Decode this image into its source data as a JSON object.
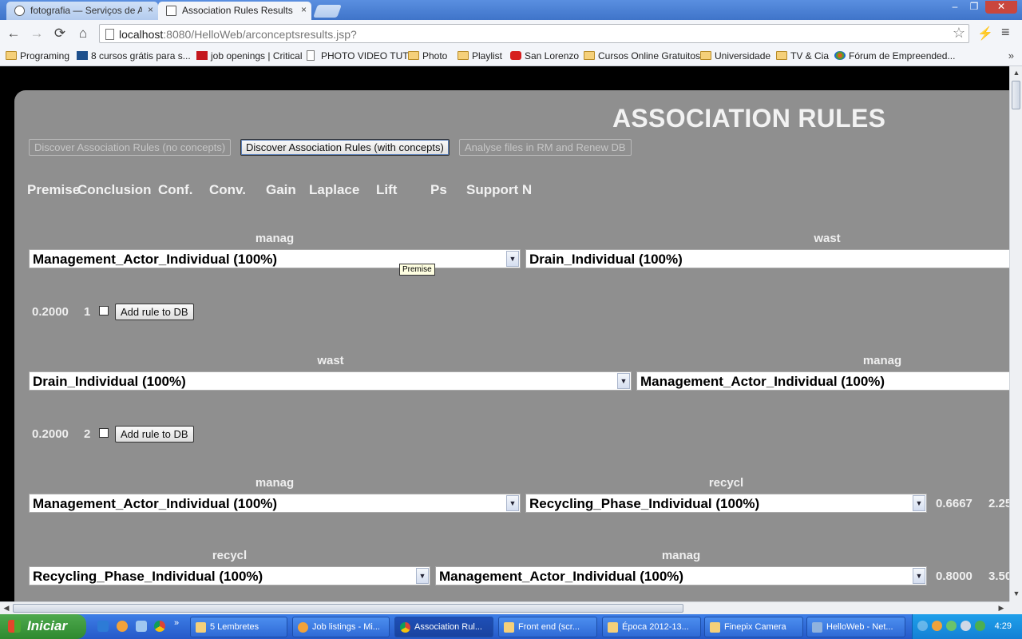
{
  "browser": {
    "tabs": [
      {
        "label": "fotografia — Serviços de Ac",
        "close": "×"
      },
      {
        "label": "Association Rules Results Pa",
        "close": "×"
      }
    ],
    "window_controls": {
      "minimize": "–",
      "restore": "❐",
      "close": "✕"
    },
    "nav": {
      "back": "←",
      "forward": "→",
      "reload": "⟳",
      "home": "⌂",
      "menu": "≡",
      "bolt": "⚡"
    },
    "url": {
      "host": "localhost",
      "path": ":8080/HelloWeb/arconceptsresults.jsp?"
    },
    "star": "☆",
    "bookmarks": [
      {
        "label": "Programing",
        "icon": "folder-icon"
      },
      {
        "label": "8 cursos grátis para s...",
        "icon": "site-icon"
      },
      {
        "label": "job openings | Critical",
        "icon": "site-icon"
      },
      {
        "label": "PHOTO VIDEO TUTS",
        "icon": "page-icon"
      },
      {
        "label": "Photo",
        "icon": "folder-icon"
      },
      {
        "label": "Playlist",
        "icon": "folder-icon"
      },
      {
        "label": "San Lorenzo",
        "icon": "youtube-icon"
      },
      {
        "label": "Cursos Online Gratuitos",
        "icon": "folder-icon"
      },
      {
        "label": "Universidade",
        "icon": "folder-icon"
      },
      {
        "label": "TV & Cia",
        "icon": "folder-icon"
      },
      {
        "label": "Fórum de Empreended...",
        "icon": "joomla-icon"
      }
    ],
    "bookmarks_more": "»"
  },
  "page": {
    "title": "ASSOCIATION RULES",
    "buttons": {
      "no_concepts": "Discover Association Rules (no concepts)",
      "with_concepts": "Discover Association Rules (with concepts)",
      "analyse": "Analyse files in RM and Renew DB"
    },
    "columns": [
      "Premise",
      "Conclusion",
      "Conf.",
      "Conv.",
      "Gain",
      "Laplace",
      "Lift",
      "Ps",
      "Support N"
    ],
    "tooltip": "Premise",
    "rules": [
      {
        "premise_cat": "manag",
        "premise": "Management_Actor_Individual (100%)",
        "conclusion_cat": "wast",
        "conclusion": "Drain_Individual (100%)",
        "conf": "",
        "conv": "",
        "support": "0.2000",
        "n": "1",
        "add_label": "Add rule to DB"
      },
      {
        "premise_cat": "wast",
        "premise": "Drain_Individual (100%)",
        "conclusion_cat": "manag",
        "conclusion": "Management_Actor_Individual (100%)",
        "conf": "",
        "conv": "",
        "support": "0.2000",
        "n": "2",
        "add_label": "Add rule to DB"
      },
      {
        "premise_cat": "manag",
        "premise": "Management_Actor_Individual (100%)",
        "conclusion_cat": "recycl",
        "conclusion": "Recycling_Phase_Individual (100%)",
        "conf": "0.6667",
        "conv": "2.25"
      },
      {
        "premise_cat": "recycl",
        "premise": "Recycling_Phase_Individual (100%)",
        "conclusion_cat": "manag",
        "conclusion": "Management_Actor_Individual (100%)",
        "conf": "0.8000",
        "conv": "3.50"
      }
    ],
    "dropdown_arrow": "▼"
  },
  "scroll": {
    "up": "▲",
    "down": "▼",
    "left": "◀",
    "right": "▶"
  },
  "taskbar": {
    "start": "Iniciar",
    "items": [
      {
        "label": "5 Lembretes"
      },
      {
        "label": "Job listings - Mi..."
      },
      {
        "label": "Association Rul..."
      },
      {
        "label": "Front end (scr..."
      },
      {
        "label": "Época 2012-13..."
      },
      {
        "label": "Finepix Camera"
      },
      {
        "label": "HelloWeb - Net..."
      }
    ],
    "clock": "4:29"
  }
}
